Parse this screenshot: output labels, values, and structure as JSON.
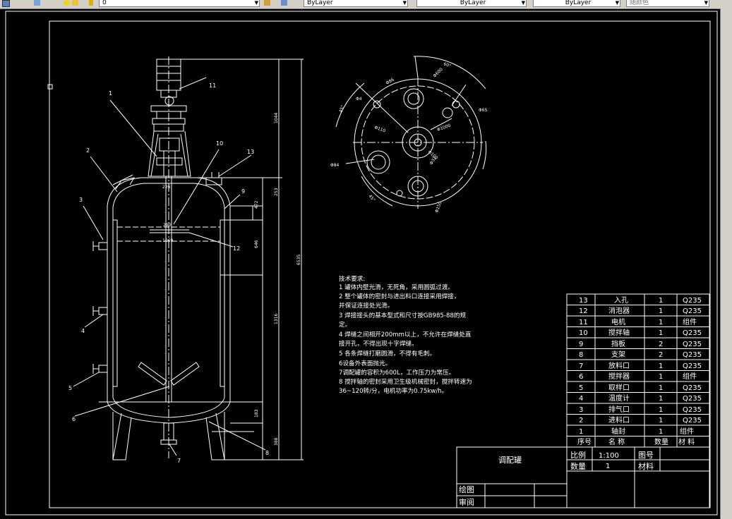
{
  "toolbar": {
    "layer_value": "0",
    "color_value": "ByLayer",
    "linetype_value": "ByLayer",
    "lineweight_value": "ByLayer",
    "plotstyle_value": "随颜色"
  },
  "drawing": {
    "callouts": [
      "1",
      "2",
      "3",
      "4",
      "5",
      "6",
      "7",
      "8",
      "9",
      "10",
      "11",
      "12",
      "13"
    ],
    "dims": {
      "d1044": "1044",
      "d253": "253",
      "d472": "472",
      "d646": "646",
      "d6535": "6535",
      "d1316": "1316",
      "d183": "183",
      "d388": "388",
      "d290": "290",
      "d1069": "1069",
      "d226": "226"
    },
    "top_view_labels": {
      "a45": "45°",
      "a60": "60°",
      "d600": "Φ600",
      "d84": "Φ4",
      "d110": "Φ110",
      "d1000": "Φ1000",
      "d84b": "Φ84",
      "d65": "Φ65",
      "d32": "Φ32",
      "d45b": "45°",
      "d150": "Φ150",
      "d86": "Φ86",
      "d100": "Φ100"
    },
    "notes_title": "技术要求:",
    "notes": [
      "1 罐体内壁光滑，无死角，采用圆弧过渡。",
      "2 整个罐体的密封与进出料口连接采用焊接，",
      "并保证连接处光滑。",
      "3 焊接接头的基本型式和尺寸按GB985-88的规",
      "定。",
      "4 焊缝之间相开200mm以上，不允许在焊缝处直",
      "接开孔，不得出现十字焊缝。",
      "5 各条焊缝打磨圆滑，不得有毛刺。",
      "6设备外表面抛光。",
      "7调配罐的容积为600L，工作压力为常压。",
      "8  搅拌轴的密封采用卫生级机械密封，搅拌转速为",
      "36~120转/分，电机功率为0.75kw/h。"
    ]
  },
  "parts_list": {
    "headers": [
      "序号",
      "名  称",
      "数量",
      "材 料"
    ],
    "rows": [
      [
        "13",
        "入孔",
        "1",
        "Q235"
      ],
      [
        "12",
        "消泡器",
        "1",
        "Q235"
      ],
      [
        "11",
        "电机",
        "1",
        "组件"
      ],
      [
        "10",
        "搅拌轴",
        "1",
        "Q235"
      ],
      [
        "9",
        "挡板",
        "2",
        "Q235"
      ],
      [
        "8",
        "支架",
        "2",
        "Q235"
      ],
      [
        "7",
        "放料口",
        "1",
        "Q235"
      ],
      [
        "6",
        "搅拌器",
        "1",
        "组件"
      ],
      [
        "5",
        "取样口",
        "1",
        "Q235"
      ],
      [
        "4",
        "温度计",
        "1",
        "Q235"
      ],
      [
        "3",
        "排气口",
        "1",
        "Q235"
      ],
      [
        "2",
        "进料口",
        "1",
        "Q235"
      ],
      [
        "1",
        "轴封",
        "1",
        "组件"
      ]
    ]
  },
  "title_block": {
    "name": "调配罐",
    "scale_label": "比例",
    "scale_value": "1:100",
    "drawing_no_label": "图号",
    "qty_label": "数量",
    "qty_value": "1",
    "material_label": "材料",
    "drawn_label": "绘图",
    "checked_label": "审阅"
  }
}
